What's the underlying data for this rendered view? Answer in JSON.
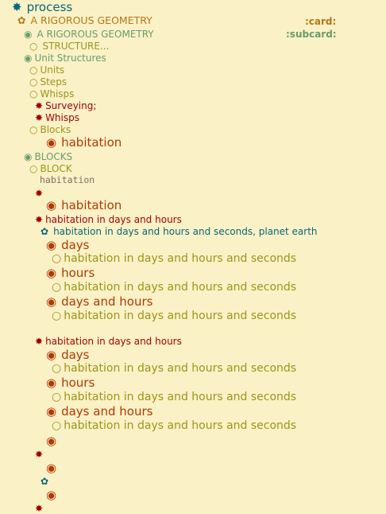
{
  "colors": {
    "background": "#fbf1c7",
    "level1": "#076678",
    "level2": "#b57614",
    "level3": "#689d6a",
    "level4": "#98971a",
    "level5": "#9d0006",
    "heading_large": "#af3a03",
    "code": "#7c6f64"
  },
  "bullets": {
    "star": "✸",
    "flower": "✿",
    "fisheye": "◉",
    "circle": "○"
  },
  "outline": {
    "process": "process",
    "rigorous_geometry": "A RIGOROUS GEOMETRY",
    "card_tag": ":card:",
    "rigorous_geometry_sub": "A RIGOROUS GEOMETRY",
    "subcard_tag": ":subcard:",
    "structure": "STRUCTURE...",
    "unit_structures": "Unit Structures",
    "units": "Units",
    "steps": "Steps",
    "whisps": "Whisps",
    "surveying": "Surveying;",
    "whisps_red": "Whisps",
    "blocks": "Blocks",
    "habitation_1": "habitation",
    "blocks_caps": "BLOCKS",
    "block": "BLOCK",
    "habitation_code": "habitation",
    "habitation_2": "habitation",
    "habitation_days_hours_1": "habitation in days and hours",
    "habitation_days_hours_seconds_earth": "habitation in days and hours and seconds, planet earth",
    "days_1": "days",
    "hdhs_1": "habitation in days and hours and seconds",
    "hours_1": "hours",
    "hdhs_2": "habitation in days and hours and seconds",
    "days_and_hours_1": "days and hours",
    "hdhs_3": "habitation in days and hours and seconds",
    "habitation_days_hours_2": "habitation in days and hours",
    "days_2": "days",
    "hdhs_4": "habitation in days and hours and seconds",
    "hours_2": "hours",
    "hdhs_5": "habitation in days and hours and seconds",
    "days_and_hours_2": "days and hours",
    "hdhs_6": "habitation in days and hours and seconds"
  }
}
